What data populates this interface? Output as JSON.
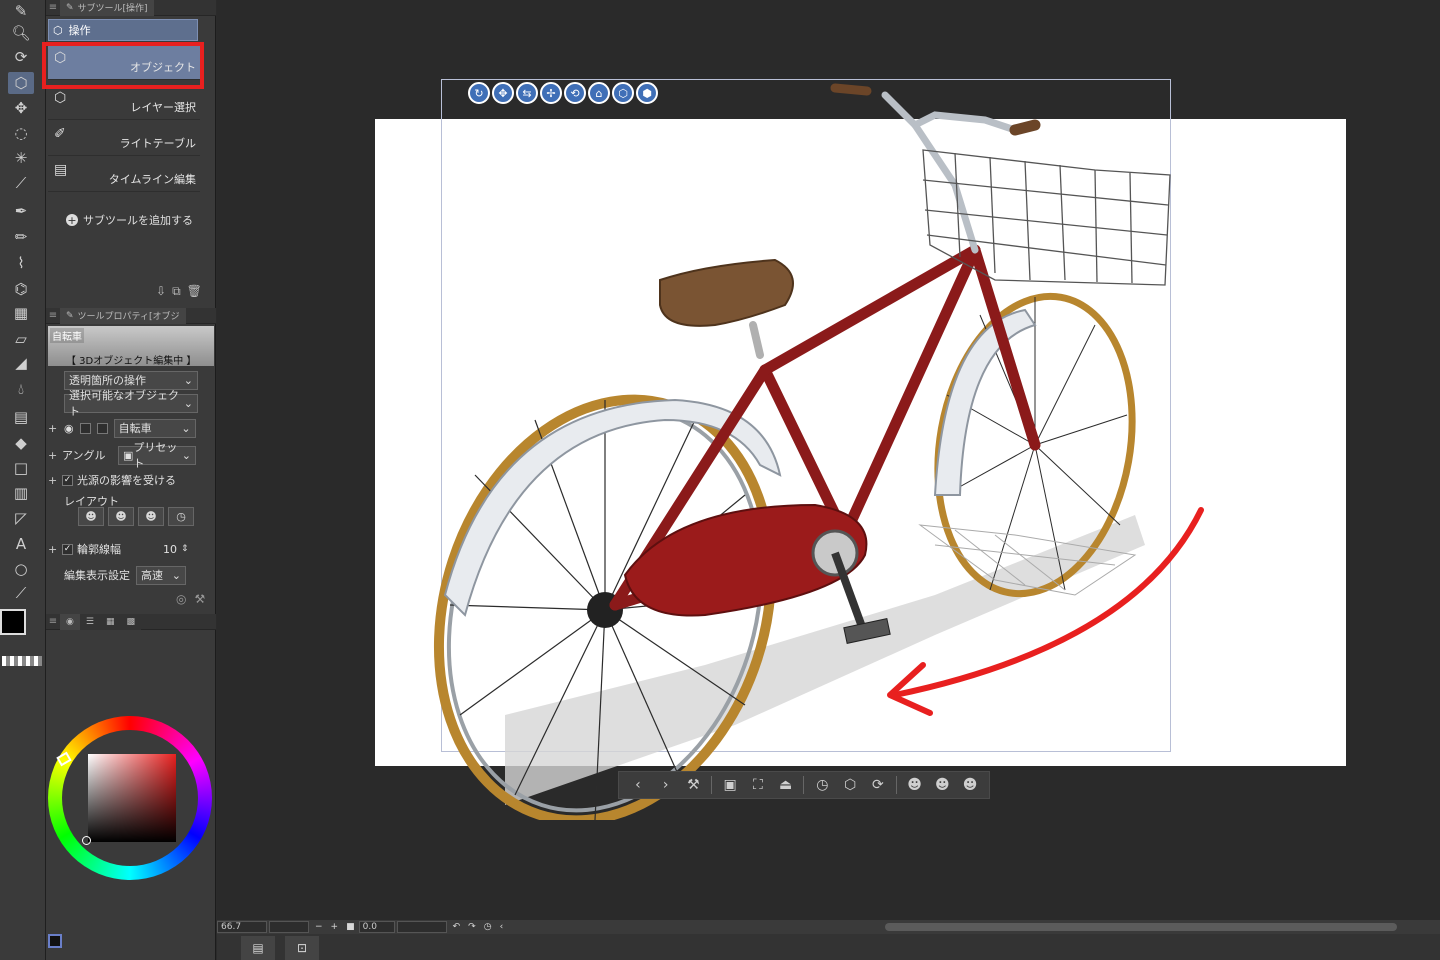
{
  "subtool_panel": {
    "tab_title": "サブツール[操作]",
    "group": "操作",
    "items": [
      {
        "label": "オブジェクト",
        "selected": true
      },
      {
        "label": "レイヤー選択",
        "selected": false
      },
      {
        "label": "ライトテーブル",
        "selected": false
      },
      {
        "label": "タイムライン編集",
        "selected": false
      }
    ],
    "add_label": "サブツールを追加する"
  },
  "tool_property": {
    "tab_title": "ツールプロパティ[オブジ",
    "object_name": "自転車",
    "editing_label": "【 3Dオブジェクト編集中 】",
    "transparent_op": "透明箇所の操作",
    "selectable": "選択可能なオブジェクト",
    "object_select": "自転車",
    "angle_label": "アングル",
    "preset_label": "プリセット",
    "light_label": "光源の影響を受ける",
    "layout_label": "レイアウト",
    "outline_label": "輪郭線幅",
    "outline_value": "10",
    "edit_display_label": "編集表示設定",
    "edit_display_value": "高速"
  },
  "status_bar": {
    "zoom": "66.7",
    "rotation": "0.0"
  },
  "colors": {
    "highlight": "#e8201f",
    "selected_item": "#6d7ea0",
    "bike_frame": "#8b1a1a",
    "arrow": "#e8201f"
  }
}
